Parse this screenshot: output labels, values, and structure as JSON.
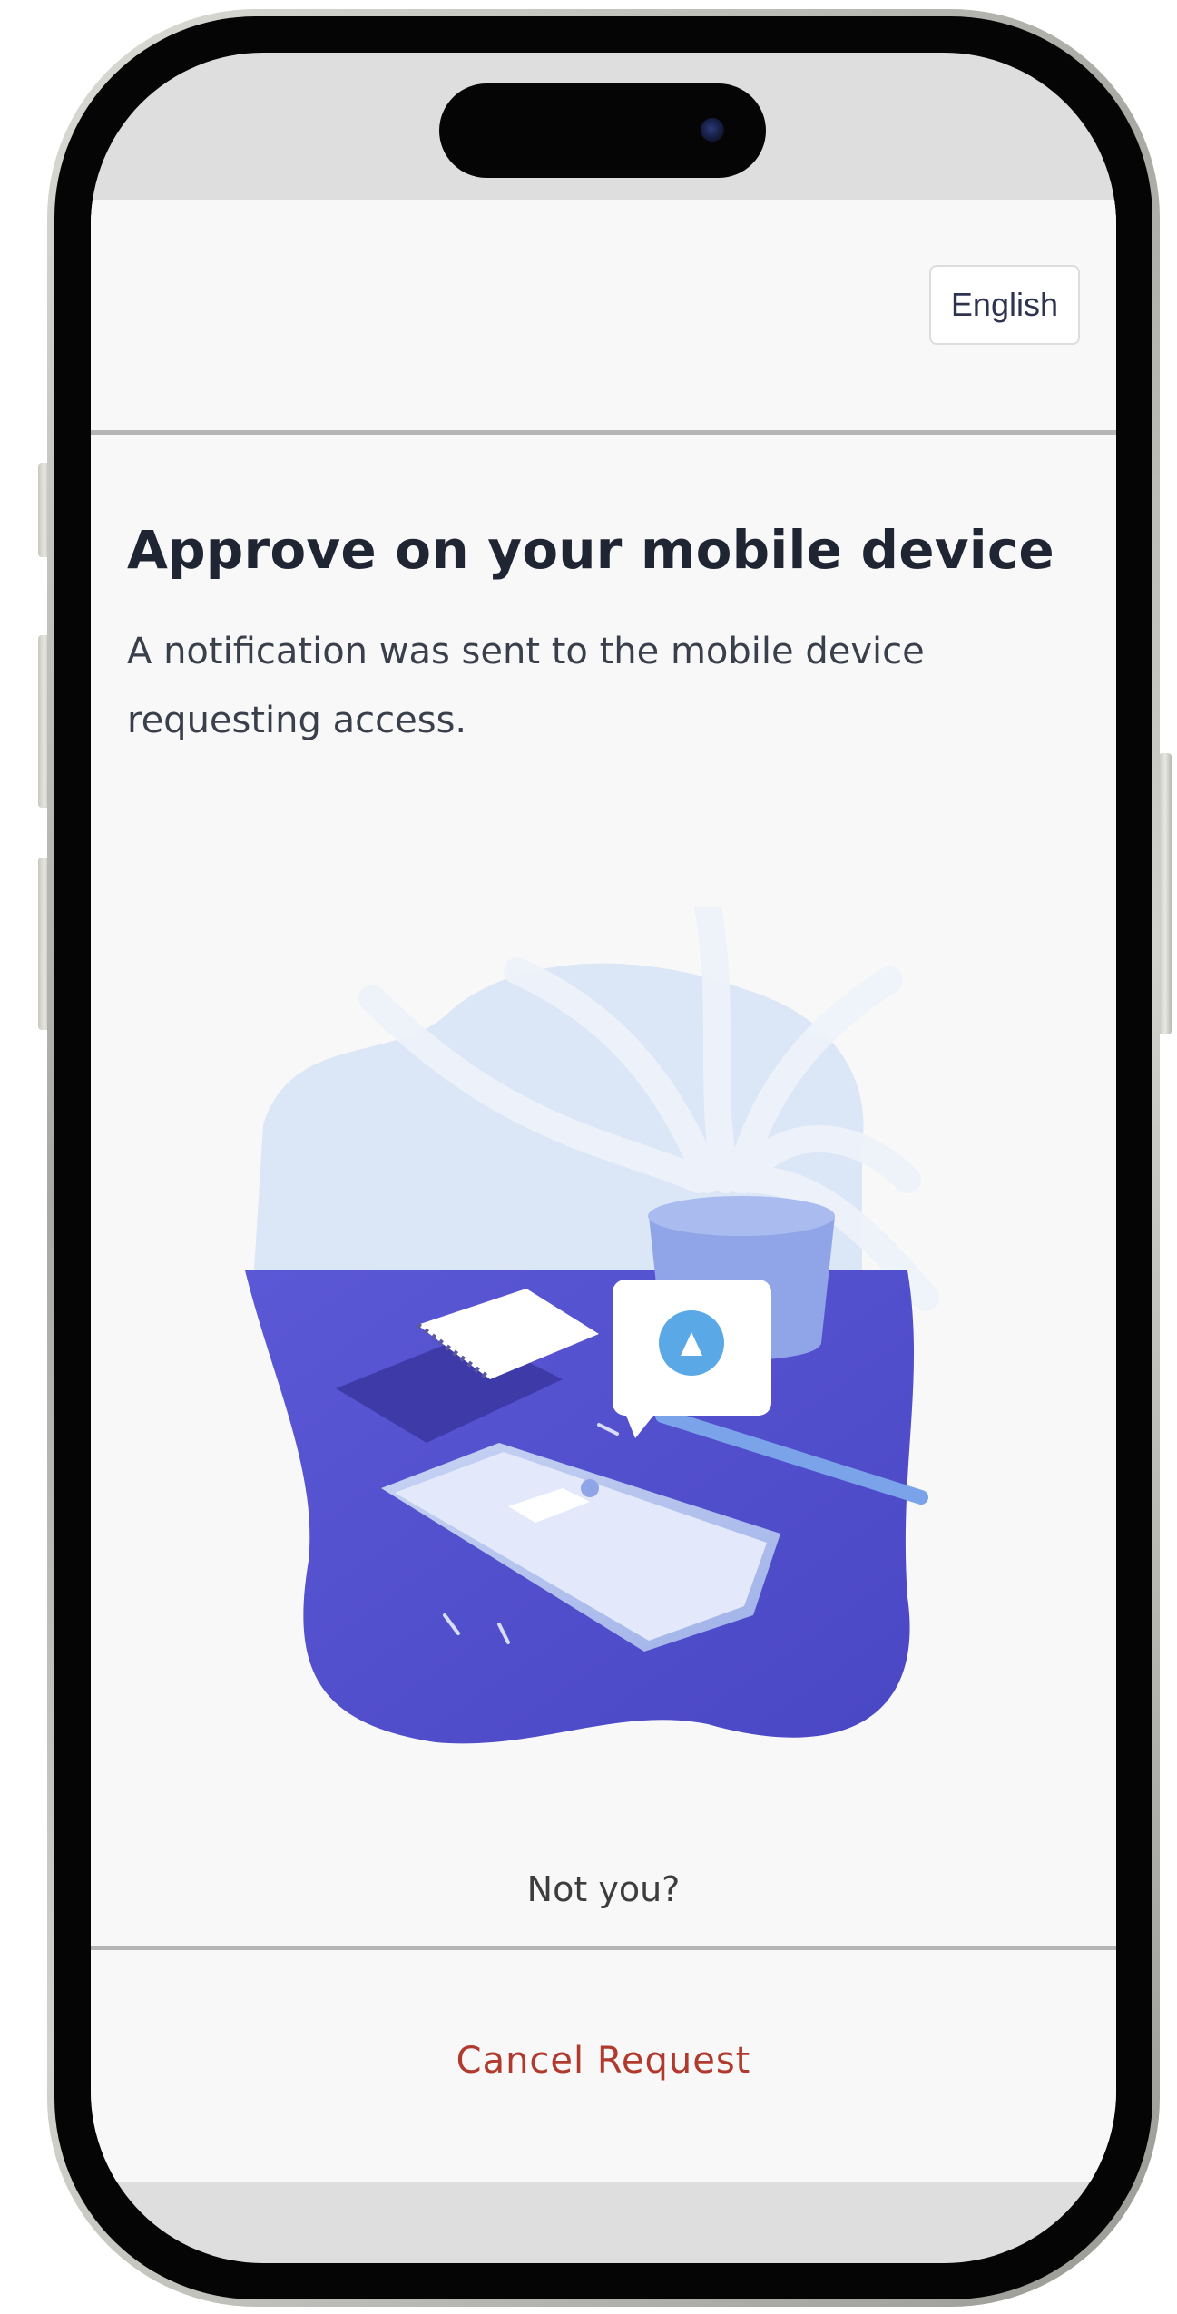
{
  "header": {
    "language_label": "English"
  },
  "main": {
    "title": "Approve on your mobile device",
    "subtitle": "A notification was sent to the mobile device requesting access."
  },
  "footer": {
    "not_you_label": "Not you?",
    "cancel_label": "Cancel Request"
  },
  "illustration": {
    "icon": "bell-icon",
    "colors": {
      "desk": "#5552d1",
      "background": "#dbe6f6",
      "accent": "#5ba8e6"
    }
  },
  "colors": {
    "cancel": "#b03a2e",
    "title": "#1f2533"
  }
}
